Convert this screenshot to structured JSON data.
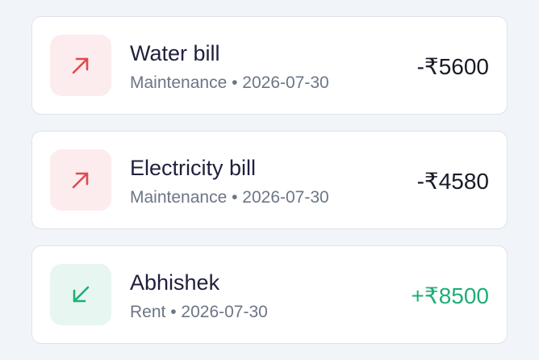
{
  "transactions": [
    {
      "title": "Water bill",
      "category": "Maintenance",
      "separator": "•",
      "date": "2026-07-30",
      "amount": "-₹5600",
      "direction": "outgoing",
      "icon": "arrow-up-right-icon",
      "color": "#e0494e"
    },
    {
      "title": "Electricity bill",
      "category": "Maintenance",
      "separator": "•",
      "date": "2026-07-30",
      "amount": "-₹4580",
      "direction": "outgoing",
      "icon": "arrow-up-right-icon",
      "color": "#e0494e"
    },
    {
      "title": "Abhishek",
      "category": "Rent",
      "separator": "•",
      "date": "2026-07-30",
      "amount": "+₹8500",
      "direction": "incoming",
      "icon": "arrow-down-left-icon",
      "color": "#1fae78"
    }
  ]
}
